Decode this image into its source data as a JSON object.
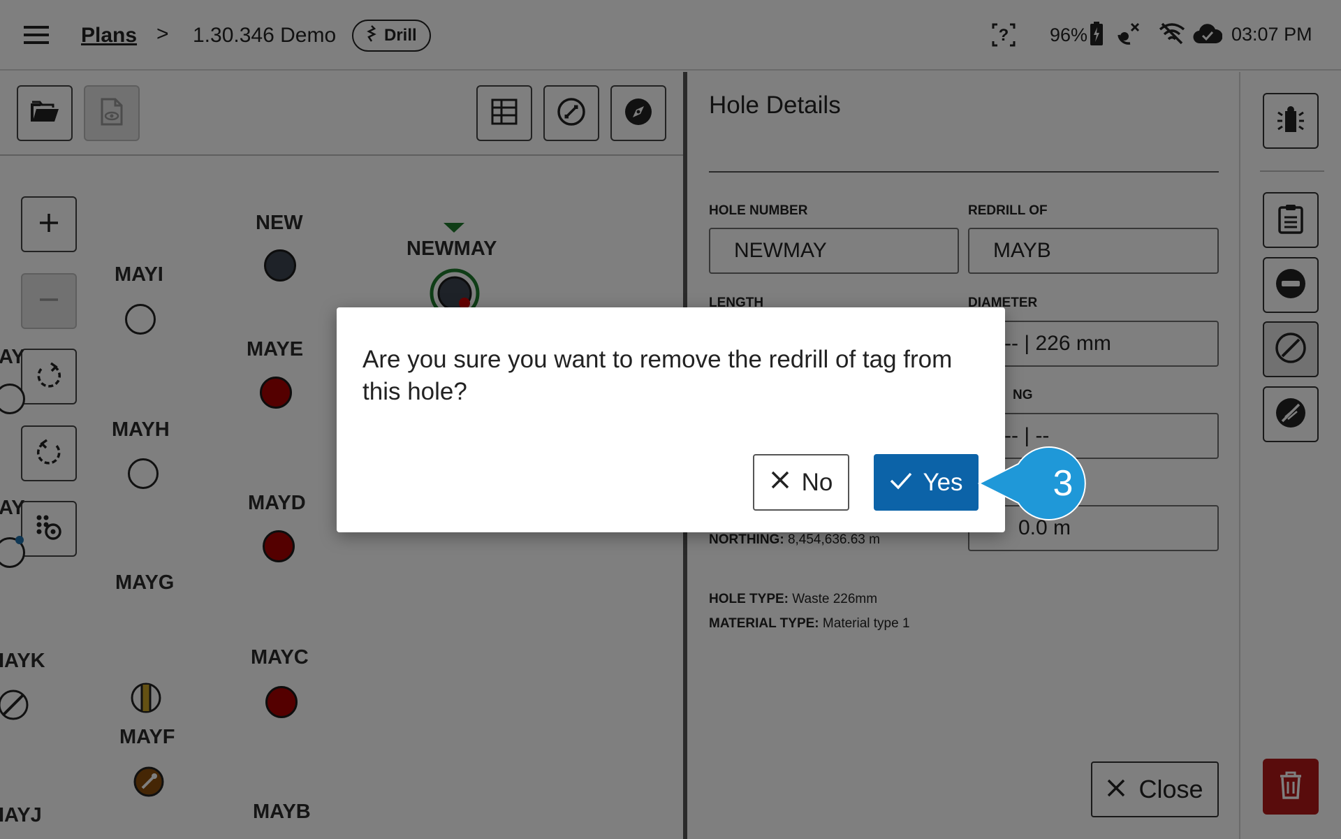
{
  "topbar": {
    "breadcrumb_root": "Plans",
    "breadcrumb_separator": ">",
    "plan_name": "1.30.346 Demo",
    "mode_badge": "Drill",
    "battery": "96%",
    "time": "03:07 PM",
    "icons": [
      "menu-icon",
      "drill-bit-icon",
      "help-icon",
      "battery-charging-icon",
      "satellite-off-icon",
      "wifi-off-icon",
      "cloud-check-icon"
    ]
  },
  "toolbar": {
    "icons": [
      "folder-open-icon",
      "file-view-icon",
      "grid-icon",
      "ruler-icon",
      "compass-icon"
    ]
  },
  "map": {
    "holes": [
      {
        "label": "NEW",
        "style": "grey"
      },
      {
        "label": "NEWMAY",
        "style": "selected"
      },
      {
        "label": "MAYI",
        "style": "empty"
      },
      {
        "label": "MAYE",
        "style": "red"
      },
      {
        "label": "MAYH",
        "style": "empty"
      },
      {
        "label": "MAYD",
        "style": "red"
      },
      {
        "label": "MAYG",
        "style": "striped"
      },
      {
        "label": "MAYC",
        "style": "red"
      },
      {
        "label": "MAYF",
        "style": "brown"
      },
      {
        "label": "MAYB",
        "style": "none"
      },
      {
        "label": "AY",
        "style": "empty"
      },
      {
        "label": "AY",
        "style": "empty"
      },
      {
        "label": "IAYK",
        "style": "slashed"
      },
      {
        "label": "IAYJ",
        "style": "none"
      }
    ],
    "controls": [
      "zoom-in-icon",
      "zoom-out-icon",
      "rotate-cw-icon",
      "rotate-ccw-icon",
      "pattern-settings-icon"
    ]
  },
  "details": {
    "title": "Hole Details",
    "hole_number_label": "HOLE NUMBER",
    "hole_number_value": "NEWMAY",
    "redrill_of_label": "REDRILL OF",
    "redrill_of_value": "MAYB",
    "length_label": "LENGTH",
    "diameter_label": "DIAMETER",
    "diameter_value": "-- | 226 mm",
    "angle_label_partial": "NG",
    "angle_value": "-- | --",
    "subdrill_value": "0.0 m",
    "northing_label": "NORTHING:",
    "northing_value": "8,454,636.63 m",
    "hole_type_label": "HOLE TYPE:",
    "hole_type_value": "Waste 226mm",
    "material_type_label": "MATERIAL TYPE:",
    "material_type_value": "Material type 1",
    "close_label": "Close"
  },
  "side_actions": {
    "icons": [
      "hole-status-icon",
      "clipboard-icon",
      "remove-circle-icon",
      "block-icon",
      "no-tag-icon",
      "trash-icon"
    ]
  },
  "dialog": {
    "message": "Are you sure you want to remove the redrill of tag from this hole?",
    "no_label": "No",
    "yes_label": "Yes"
  },
  "callout": {
    "step": "3",
    "color": "#1f98d8"
  },
  "colors": {
    "yes_button": "#0c63a8",
    "danger": "#b21818",
    "hole_red": "#a80000",
    "selected_ring": "#1f7a2c"
  }
}
